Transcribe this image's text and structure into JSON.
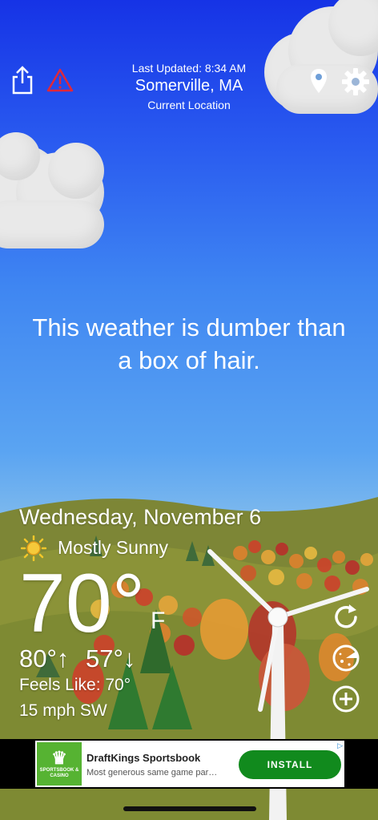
{
  "header": {
    "last_updated": "Last Updated: 8:34 AM",
    "city": "Somerville, MA",
    "location_label": "Current Location"
  },
  "toolbar": {
    "left_icons": [
      "share-icon",
      "alert-icon"
    ],
    "right_icons": [
      "location-pin-icon",
      "gear-icon"
    ]
  },
  "quote": {
    "line1": "This weather is dumber than",
    "line2": "a box of hair."
  },
  "weather": {
    "date": "Wednesday, November 6",
    "condition": "Mostly Sunny",
    "condition_icon": "sun-icon",
    "temperature": "70°",
    "unit": "F",
    "high": "80°",
    "low": "57°",
    "feels_like": "Feels Like: 70°",
    "wind": "15 mph SW"
  },
  "side_buttons": [
    "refresh-icon",
    "radar-icon",
    "add-icon"
  ],
  "ad": {
    "logo_text": "SPORTSBOOK & CASINO",
    "title": "DraftKings Sportsbook",
    "subtitle": "Most generous same game par…",
    "button": "INSTALL",
    "brand_color": "#56b332",
    "button_color": "#118a1d"
  },
  "colors": {
    "sky_top": "#1633e6",
    "sky_bottom": "#9cc5df",
    "hill": "#8a8f3a"
  }
}
